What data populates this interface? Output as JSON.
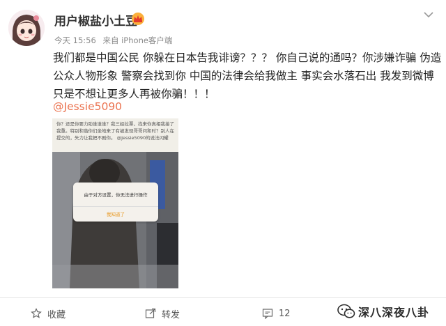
{
  "post": {
    "username": "用户椒盐小土豆",
    "time": "今天 15:56",
    "source": "来自 iPhone客户端",
    "text": "我们都是中国公民 你躲在日本告我诽谤？？？ 你自己说的通吗？你涉嫌诈骗 伪造公众人物形象 警察会找到你 中国的法律会给我做主 事实会水落石出 我发到微博只是不想让更多人再被你骗！！！",
    "mention": "@Jessie5090"
  },
  "image": {
    "top_text": "你？还是你要力助谁谁谁？我三经拉票，找来你真相我接了我重。特别和谐你们坐地来了有被发现哥哥问和时？别人在提交的，失力让我把不剧你。 @Jessie5090的说法闪耀",
    "dialog_message": "由于对方设置，你无法进行操作",
    "dialog_button": "我知道了"
  },
  "footer": {
    "favorite": "收藏",
    "repost": "转发",
    "comments": "12"
  },
  "watermark": "深八深夜八卦",
  "icons": {
    "avatar": "avatar-anime-girl",
    "badge": "vip-crown-icon",
    "more": "chevron-down-icon",
    "favorite": "star-icon",
    "repost": "share-icon",
    "comment": "comment-icon",
    "watermark": "wechat-icon"
  },
  "colors": {
    "mention": "#eb7350",
    "dialog_button": "#e8961c"
  }
}
